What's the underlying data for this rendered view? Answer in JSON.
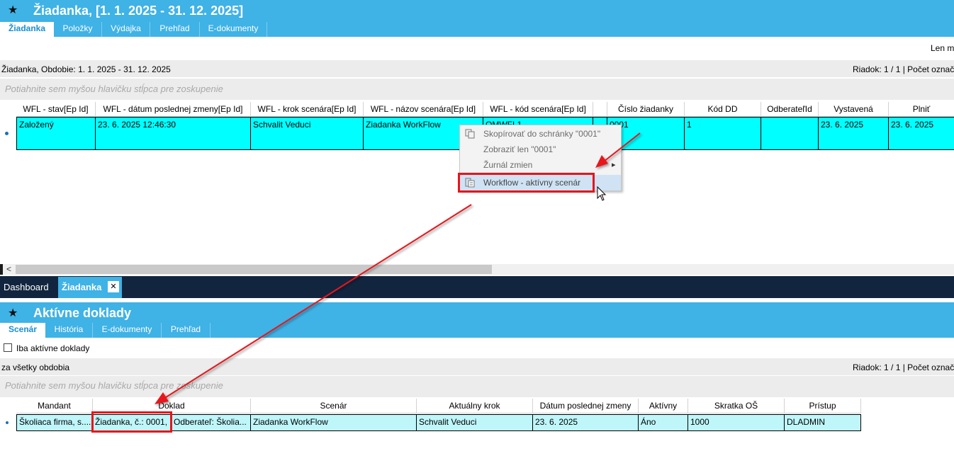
{
  "top_window": {
    "star_icon": "★",
    "title": "Žiadanka,  [1. 1. 2025 - 31. 12. 2025]",
    "tabs": [
      "Žiadanka",
      "Položky",
      "Výdajka",
      "Prehľad",
      "E-dokumenty"
    ],
    "right_cut_label": "Len mo",
    "info_left": "Žiadanka, Obdobie: 1. 1. 2025 - 31. 12. 2025",
    "info_right": "Riadok: 1 / 1 | Počet označ",
    "group_hint": "Potiahnite sem myšou hlavičku stĺpca pre zoskupenie",
    "columns": [
      "WFL - stav[Ep Id]",
      "WFL - dátum poslednej zmeny[Ep Id]",
      "WFL - krok scenára[Ep Id]",
      "WFL - názov scenára[Ep Id]",
      "WFL - kód scenára[Ep Id]",
      "",
      "Číslo žiadanky",
      "Kód DD",
      "OdberateľId",
      "Vystavená",
      "Plniť"
    ],
    "row": [
      "Založený",
      "23. 6. 2025 12:46:30",
      "Schvalit Veduci",
      "Ziadanka WorkFlow",
      "OMWFL1",
      "",
      "0001",
      "1",
      "",
      "23. 6. 2025",
      "23. 6. 2025"
    ],
    "scroll_left": "<"
  },
  "context_menu": {
    "items": [
      "Skopírovať do schránky \"0001\"",
      "Zobraziť len \"0001\"",
      "Žurnál zmien",
      "Workflow - aktívny scenár"
    ],
    "submenu_arrow": "▸"
  },
  "doc_tabs": {
    "items": [
      "Dashboard",
      "Žiadanka"
    ],
    "close": "✕"
  },
  "bottom_window": {
    "star_icon": "★",
    "title": "Aktívne doklady",
    "tabs": [
      "Scenár",
      "História",
      "E-dokumenty",
      "Prehľad"
    ],
    "checkbox_label": "Iba aktívne doklady",
    "info_left": "za všetky obdobia",
    "info_right": "Riadok: 1 / 1 | Počet označ",
    "group_hint": "Potiahnite sem myšou hlavičku stĺpca pre zoskupenie",
    "columns": [
      "Mandant",
      "Doklad",
      "Scenár",
      "Aktuálny krok",
      "Dátum poslednej zmeny",
      "Aktívny",
      "Skratka OŠ",
      "Prístup"
    ],
    "row": [
      "Školiaca firma, s....",
      "Žiadanka,  č.: 0001,",
      "Odberateľ: Školia...",
      "Ziadanka WorkFlow",
      "Schvalit Veduci",
      "23. 6. 2025",
      "Áno",
      "1000",
      "DLADMIN"
    ]
  },
  "colors": {
    "accent_blue": "#3fb2e6",
    "row_cyan": "#00ffff",
    "row_cyan_light": "#bff6f9",
    "annotation_red": "#e8141a",
    "dark_strip": "#12253f"
  }
}
